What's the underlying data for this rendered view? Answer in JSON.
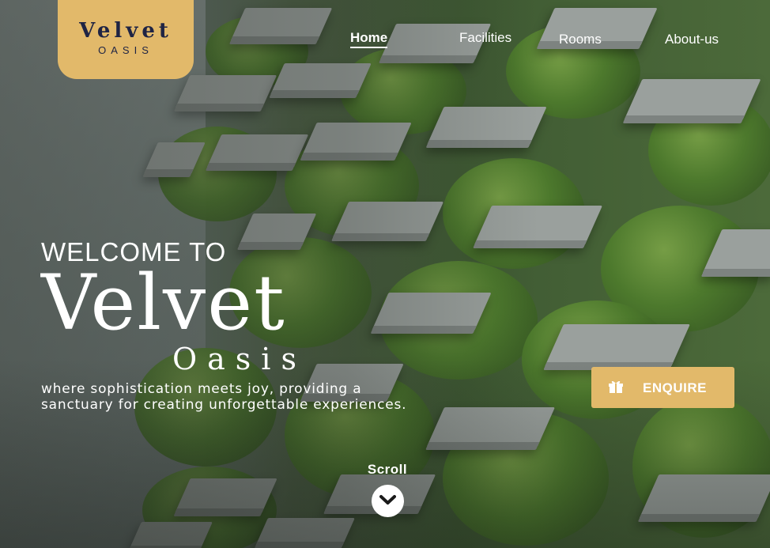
{
  "brand": {
    "name": "Velvet",
    "sub": "OASIS",
    "color": "#e2b96a",
    "text_color": "#1f2444"
  },
  "nav": [
    {
      "label": "Home",
      "active": true
    },
    {
      "label": "Facilities",
      "active": false
    },
    {
      "label": "Rooms",
      "active": false
    },
    {
      "label": "About-us",
      "active": false
    }
  ],
  "hero": {
    "welcome": "WELCOME TO",
    "title": "Velvet",
    "subtitle": "Oasis",
    "tagline_line1": "where sophistication meets joy, providing a",
    "tagline_line2": "sanctuary for creating unforgettable experiences.",
    "enquire_label": "ENQUIRE",
    "enquire_icon": "gift-icon",
    "scroll_label": "Scroll",
    "scroll_icon": "chevron-down-icon"
  }
}
